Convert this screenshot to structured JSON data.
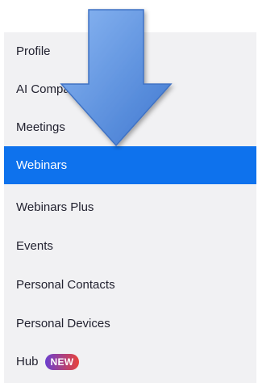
{
  "sidebar": {
    "items": [
      {
        "label": "Profile",
        "active": false
      },
      {
        "label": "AI Companion",
        "active": false
      },
      {
        "label": "Meetings",
        "active": false
      },
      {
        "label": "Webinars",
        "active": true
      },
      {
        "label": "Webinars Plus",
        "active": false
      },
      {
        "label": "Events",
        "active": false
      },
      {
        "label": "Personal Contacts",
        "active": false
      },
      {
        "label": "Personal Devices",
        "active": false
      },
      {
        "label": "Hub",
        "active": false,
        "badge": "NEW"
      }
    ]
  },
  "colors": {
    "sidebar_bg": "#f1f1f3",
    "active_bg": "#0e72ed",
    "active_text": "#ffffff",
    "text": "#222230",
    "badge_gradient_start": "#6a3fd0",
    "badge_gradient_end": "#e8433a",
    "arrow_fill": "#5e97e6",
    "arrow_stroke": "#3f72c4"
  },
  "annotation": {
    "icon": "down-arrow-icon"
  }
}
